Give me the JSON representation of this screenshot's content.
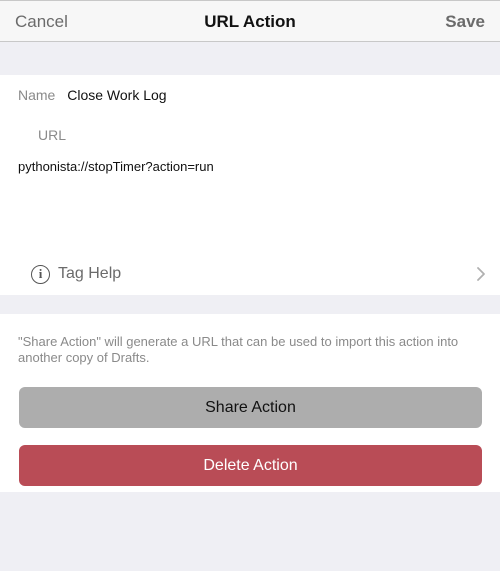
{
  "navbar": {
    "cancel_label": "Cancel",
    "title": "URL Action",
    "save_label": "Save"
  },
  "form": {
    "name_label": "Name",
    "name_value": "Close Work Log",
    "url_label": "URL",
    "url_value": "pythonista://stopTimer?action=run"
  },
  "tag_help": {
    "icon_glyph": "i",
    "label": "Tag Help",
    "icon": "info-icon",
    "chevron": "chevron-right-icon"
  },
  "footer": {
    "text": "\"Share Action\" will generate a URL that can be used to import this action into another copy of Drafts."
  },
  "buttons": {
    "share_label": "Share Action",
    "delete_label": "Delete Action"
  },
  "colors": {
    "background": "#efeff4",
    "navbar": "#f7f7f7",
    "share_button": "#adadad",
    "delete_button": "#b94c56",
    "muted_text": "#8a8a8a"
  }
}
